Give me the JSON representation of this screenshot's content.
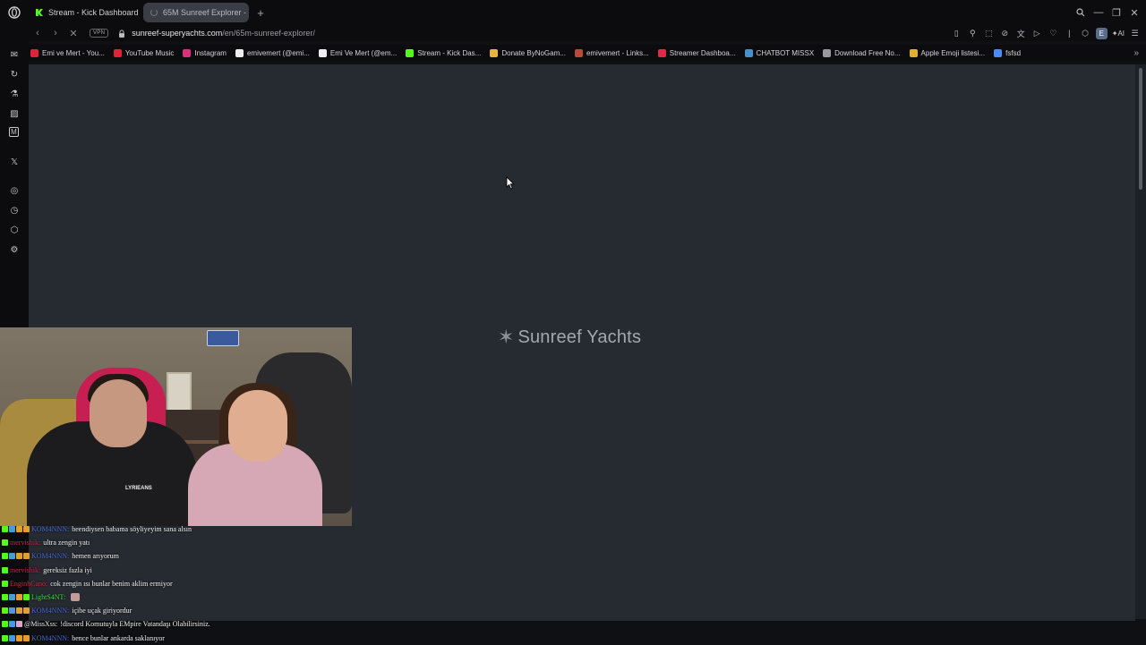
{
  "tabs": [
    {
      "label": "Stream - Kick Dashboard",
      "active": false
    },
    {
      "label": "65M Sunreef Explorer - S…",
      "active": true
    }
  ],
  "address": {
    "vpn_label": "VPN",
    "host": "sunreef-superyachts.com",
    "path": "/en/65m-sunreef-explorer/"
  },
  "toolbar": {
    "profile_initial": "E",
    "ai_label": "AI"
  },
  "bookmarks": [
    {
      "label": "Emi ve Mert - You...",
      "color": "#e0223a"
    },
    {
      "label": "YouTube Music",
      "color": "#e0223a"
    },
    {
      "label": "Instagram",
      "color": "#d9317a"
    },
    {
      "label": "emivemert (@emi...",
      "color": "#eeeeee"
    },
    {
      "label": "Emi Ve Mert (@em...",
      "color": "#eeeeee"
    },
    {
      "label": "Stream - Kick Das...",
      "color": "#53fc18"
    },
    {
      "label": "Donate ByNoGam...",
      "color": "#e7b53c"
    },
    {
      "label": "emivemert - Links...",
      "color": "#b84a3a"
    },
    {
      "label": "Streamer Dashboa...",
      "color": "#e0284a"
    },
    {
      "label": "CHATBOT MISSX",
      "color": "#4a90c8"
    },
    {
      "label": "Download Free No...",
      "color": "#999999"
    },
    {
      "label": "Apple Emoji listesi...",
      "color": "#e0b030"
    },
    {
      "label": "fsfsd",
      "color": "#4c8bf5"
    }
  ],
  "page": {
    "logo_text": "Sunreef Yachts"
  },
  "webcam": {
    "shirt_text": "LYRIEANS"
  },
  "chat": [
    {
      "user": "KOM4NNN:",
      "user_color": "#4a6ad8",
      "message": "beendiysen babama söyliyeyim sana alsın",
      "badges": [
        "#53fc18",
        "#4a9ad8",
        "#e0a030",
        "#e0a030"
      ]
    },
    {
      "user": "mervishik:",
      "user_color": "#c0284a",
      "message": "ultra zengin yatı",
      "badges": [
        "#53fc18"
      ]
    },
    {
      "user": "KOM4NNN:",
      "user_color": "#4a6ad8",
      "message": "hemen arıyorum",
      "badges": [
        "#53fc18",
        "#4a9ad8",
        "#e0a030",
        "#e0a030"
      ]
    },
    {
      "user": "mervishik:",
      "user_color": "#c0284a",
      "message": "gereksiz fazla iyi",
      "badges": [
        "#53fc18"
      ]
    },
    {
      "user": "EnginhCano:",
      "user_color": "#d8283a",
      "message": "cok zengin ısı bunlar benim aklim ermiyor",
      "badges": [
        "#53fc18"
      ]
    },
    {
      "user": "LightS4NT:",
      "user_color": "#3ad84a",
      "message": "",
      "badges": [
        "#53fc18",
        "#4a9ad8",
        "#e0a030",
        "#53fc18"
      ],
      "emote": true
    },
    {
      "user": "KOM4NNN:",
      "user_color": "#4a6ad8",
      "message": "içibe uçak giriyordur",
      "badges": [
        "#53fc18",
        "#4a9ad8",
        "#e0a030",
        "#e0a030"
      ]
    },
    {
      "user": "@MissXss:",
      "user_color": "#e8e8e8",
      "message": "!discord Komutuyla EMpire Vatandaşı Olabilirsiniz.",
      "badges": [
        "#53fc18",
        "#4a9ad8",
        "#d8a8c8"
      ]
    },
    {
      "user": "KOM4NNN:",
      "user_color": "#4a6ad8",
      "message": "bence bunlar ankarda saklanıyor",
      "badges": [
        "#53fc18",
        "#4a9ad8",
        "#e0a030",
        "#e0a030"
      ]
    }
  ]
}
